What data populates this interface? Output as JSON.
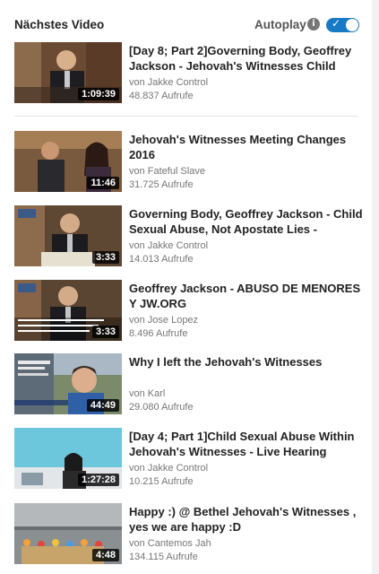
{
  "header": {
    "title": "Nächstes Video",
    "autoplay_label": "Autoplay",
    "autoplay_on": true,
    "info_icon": "info-icon"
  },
  "videos": [
    {
      "title": "[Day 8; Part 2]Governing Body, Geoffrey Jackson - Jehovah's Witnesses Child Sexual",
      "channel": "von Jakke Control",
      "views": "48.837 Aufrufe",
      "duration": "1:09:39"
    },
    {
      "title": "Jehovah's Witnesses Meeting Changes 2016",
      "channel": "von Fateful Slave",
      "views": "31.725 Aufrufe",
      "duration": "11:46"
    },
    {
      "title": "Governing Body, Geoffrey Jackson - Child Sexual Abuse, Not Apostate Lies - Jehovah's",
      "channel": "von Jakke Control",
      "views": "14.013 Aufrufe",
      "duration": "3:33"
    },
    {
      "title": "Geoffrey Jackson - ABUSO DE MENORES Y JW.ORG",
      "channel": "von Jose Lopez",
      "views": "8.496 Aufrufe",
      "duration": "3:33"
    },
    {
      "title": "Why I left the Jehovah's Witnesses",
      "channel": "von Karl",
      "views": "29.080 Aufrufe",
      "duration": "44:49"
    },
    {
      "title": "[Day 4; Part 1]Child Sexual Abuse Within Jehovah's Witnesses - Live Hearing",
      "channel": "von Jakke Control",
      "views": "10.215 Aufrufe",
      "duration": "1:27:28"
    },
    {
      "title": "Happy :) @ Bethel Jehovah's Witnesses , yes we are happy :D",
      "channel": "von Cantemos Jah",
      "views": "134.115 Aufrufe",
      "duration": "4:48"
    }
  ],
  "colors": {
    "accent": "#167ac6",
    "title_text": "#222222",
    "meta_text": "#767676"
  }
}
